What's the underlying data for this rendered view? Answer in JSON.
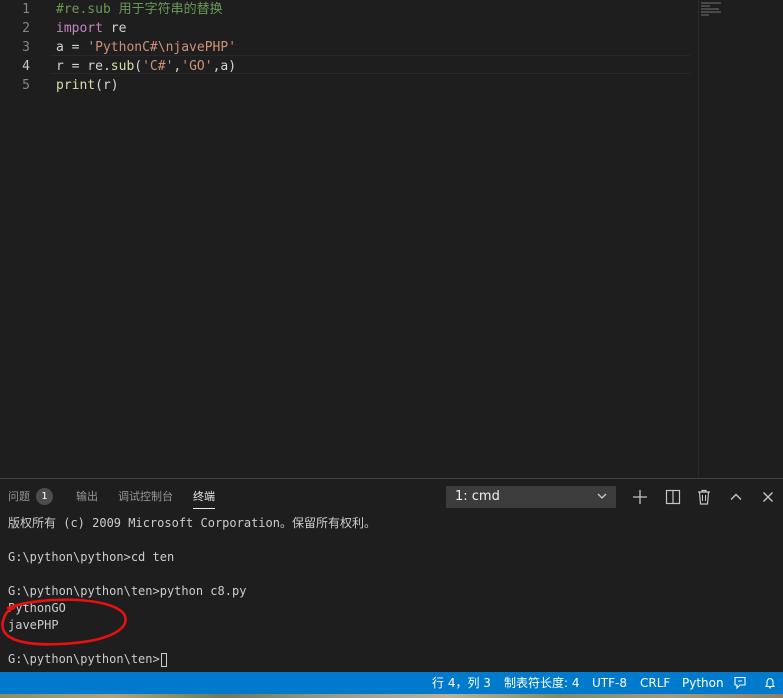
{
  "editor": {
    "lines": [
      {
        "num": "1",
        "tokens": [
          {
            "t": "#re.sub 用于字符串的替换",
            "c": "tk-comment"
          }
        ]
      },
      {
        "num": "2",
        "tokens": [
          {
            "t": "import",
            "c": "tk-keyword"
          },
          {
            "t": " re",
            "c": "tk-plain"
          }
        ]
      },
      {
        "num": "3",
        "tokens": [
          {
            "t": "a = ",
            "c": "tk-plain"
          },
          {
            "t": "'PythonC#\\njavePHP'",
            "c": "tk-string"
          }
        ]
      },
      {
        "num": "4",
        "tokens": [
          {
            "t": "r = re.",
            "c": "tk-plain"
          },
          {
            "t": "sub",
            "c": "tk-func"
          },
          {
            "t": "(",
            "c": "tk-plain"
          },
          {
            "t": "'C#'",
            "c": "tk-string"
          },
          {
            "t": ",",
            "c": "tk-plain"
          },
          {
            "t": "'GO'",
            "c": "tk-string"
          },
          {
            "t": ",a)",
            "c": "tk-plain"
          }
        ]
      },
      {
        "num": "5",
        "tokens": [
          {
            "t": "print",
            "c": "tk-func"
          },
          {
            "t": "(r)",
            "c": "tk-plain"
          }
        ]
      }
    ],
    "active_line": 4
  },
  "panel": {
    "tabs": [
      {
        "label": "问题",
        "badge": "1"
      },
      {
        "label": "输出"
      },
      {
        "label": "调试控制台"
      },
      {
        "label": "终端"
      }
    ],
    "active_tab": "终端",
    "terminal_select": "1: cmd",
    "actions": [
      "plus-icon",
      "split-icon",
      "trash-icon",
      "chevron-up-icon",
      "close-icon"
    ]
  },
  "terminal": {
    "lines": [
      "版权所有 (c) 2009 Microsoft Corporation。保留所有权利。",
      "",
      "G:\\python\\python>cd ten",
      "",
      "G:\\python\\python\\ten>python c8.py",
      "PythonGO",
      "javePHP",
      "",
      "G:\\python\\python\\ten>"
    ]
  },
  "statusbar": {
    "position": "行 4，列 3",
    "indent": "制表符长度: 4",
    "encoding": "UTF-8",
    "eol": "CRLF",
    "language": "Python"
  },
  "colors": {
    "editor_bg": "#1e1e1e",
    "status_bg": "#007acc",
    "annotation": "#e81010"
  }
}
